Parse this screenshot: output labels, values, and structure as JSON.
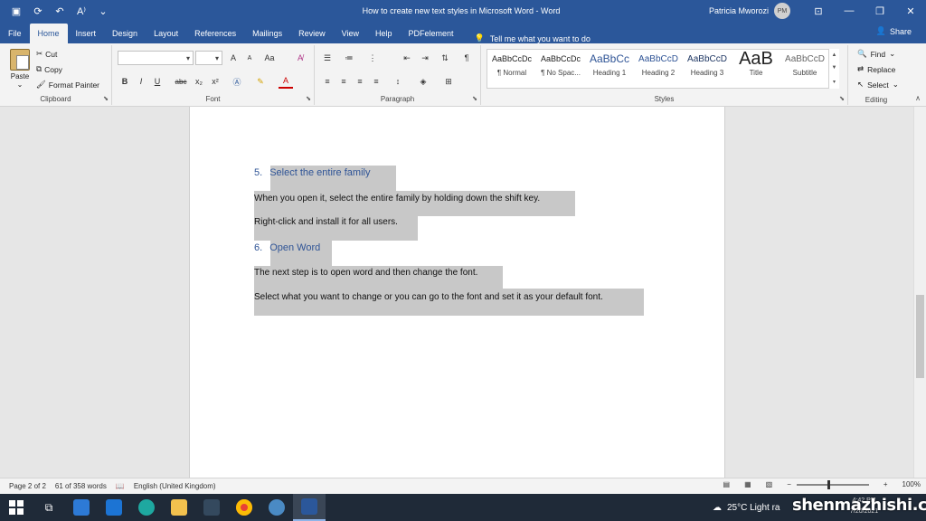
{
  "window": {
    "title": "How to create new text styles in Microsoft Word  -  Word",
    "user_name": "Patricia Mworozi",
    "user_initials": "PM"
  },
  "tabs": [
    "File",
    "Home",
    "Insert",
    "Design",
    "Layout",
    "References",
    "Mailings",
    "Review",
    "View",
    "Help",
    "PDFelement"
  ],
  "tell_me": "Tell me what you want to do",
  "share_label": "Share",
  "ribbon": {
    "clipboard": {
      "paste": "Paste",
      "cut": "Cut",
      "copy": "Copy",
      "format_painter": "Format Painter",
      "label": "Clipboard"
    },
    "font": {
      "label": "Font",
      "bold": "B",
      "italic": "I",
      "underline": "U",
      "strike": "abc",
      "sub": "x₂",
      "sup": "x²",
      "case": "Aa",
      "grow": "A",
      "shrink": "A"
    },
    "paragraph": {
      "label": "Paragraph",
      "pilcrow": "¶"
    },
    "styles": {
      "label": "Styles",
      "items": [
        {
          "preview": "AaBbCcDc",
          "name": "¶ Normal"
        },
        {
          "preview": "AaBbCcDc",
          "name": "¶ No Spac..."
        },
        {
          "preview": "AaBbCc",
          "name": "Heading 1"
        },
        {
          "preview": "AaBbCcD",
          "name": "Heading 2"
        },
        {
          "preview": "AaBbCcD",
          "name": "Heading 3"
        },
        {
          "preview": "AaB",
          "name": "Title"
        },
        {
          "preview": "AaBbCcD",
          "name": "Subtitle"
        }
      ]
    },
    "editing": {
      "label": "Editing",
      "find": "Find",
      "replace": "Replace",
      "select": "Select"
    }
  },
  "document": {
    "heading5_num": "5.",
    "heading5": "Select the entire family",
    "p1": "When you open it, select the entire family by holding down the shift key.",
    "p2": "Right-click and install it for all users.",
    "heading6_num": "6.",
    "heading6": "Open Word",
    "p3": "The next step is to open word and then change the font.",
    "p4": "Select what you want to change or you can go to the font and set it as your default font."
  },
  "status": {
    "page": "Page 2 of 2",
    "words": "61 of 358 words",
    "language": "English (United Kingdom)",
    "zoom": "100%"
  },
  "taskbar": {
    "weather": "25°C  Light ra",
    "watermark": "shenmazhishi.com",
    "clock_time": "4:42 PM",
    "clock_date": "7/20/2021"
  },
  "colors": {
    "word_blue": "#2b579a",
    "heading": "#2f5496",
    "selection": "#c8c8c8"
  }
}
